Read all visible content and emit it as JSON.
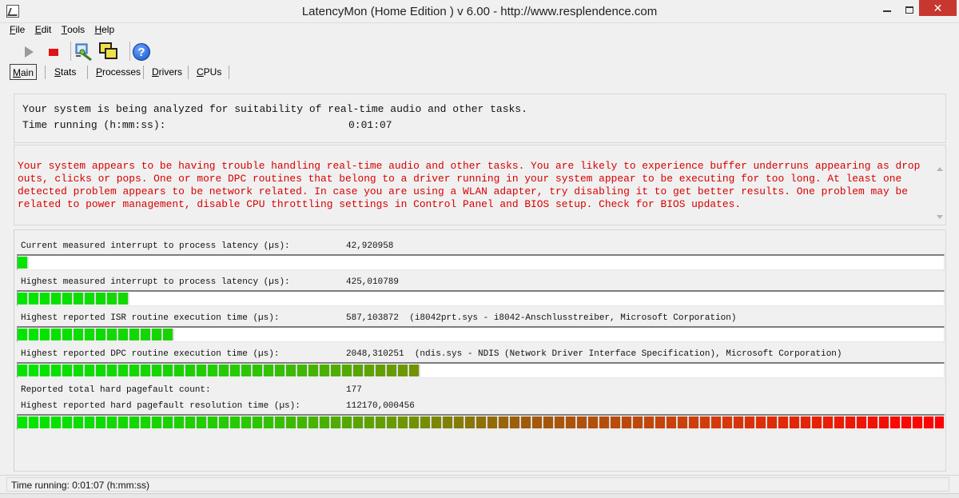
{
  "window": {
    "title": "LatencyMon  (Home Edition )  v 6.00 - http://www.resplendence.com"
  },
  "menu": [
    {
      "label": "File",
      "key": "F",
      "rest": "ile"
    },
    {
      "label": "Edit",
      "key": "E",
      "rest": "dit"
    },
    {
      "label": "Tools",
      "key": "T",
      "rest": "ools"
    },
    {
      "label": "Help",
      "key": "H",
      "rest": "elp"
    }
  ],
  "toolbar": {
    "icons": [
      "play-icon",
      "stop-icon",
      "tool-icon",
      "windows-icon",
      "help-icon"
    ],
    "help_glyph": "?"
  },
  "tabs": [
    {
      "label": "Main",
      "key": "M",
      "rest": "ain",
      "active": true
    },
    {
      "label": "Stats",
      "key": "S",
      "rest": "tats",
      "active": false
    },
    {
      "label": "Processes",
      "key": "P",
      "rest": "rocesses",
      "active": false
    },
    {
      "label": "Drivers",
      "key": "D",
      "rest": "rivers",
      "active": false
    },
    {
      "label": "CPUs",
      "key": "C",
      "rest": "PUs",
      "active": false
    }
  ],
  "status": {
    "line1": "Your system is being analyzed for suitability of real-time audio and other tasks.",
    "time_label": "Time running (h:mm:ss):",
    "time_value": "0:01:07"
  },
  "warning": {
    "text": "Your system appears to be having trouble handling real-time audio and other tasks. You are likely to experience buffer underruns appearing as drop outs, clicks or pops. One or more DPC routines that belong to a driver running in your system appear to be executing for too long. At least one detected problem appears to be network related. In case you are using a WLAN adapter, try disabling it to get better results. One problem may be related to power management, disable CPU throttling settings in Control Panel and BIOS setup. Check for BIOS updates.",
    "color": "#d90000"
  },
  "metrics": [
    {
      "label": "Current measured interrupt to process latency (µs):",
      "value": "42,920958",
      "fill": 0.012
    },
    {
      "label": "Highest measured interrupt to process latency (µs):",
      "value": "425,010789",
      "fill": 0.123
    },
    {
      "label": "Highest reported ISR routine execution time (µs):",
      "value": "587,103872  (i8042prt.sys - i8042-Anschlusstreiber, Microsoft Corporation)",
      "fill": 0.164
    },
    {
      "label": "Highest reported DPC routine execution time (µs):",
      "value": "2048,310251  (ndis.sys - NDIS (Network Driver Interface Specification), Microsoft Corporation)",
      "fill": 0.44
    },
    {
      "label": "Reported total hard pagefault count:",
      "value": "177",
      "fill": null
    },
    {
      "label": "Highest reported hard pagefault resolution time (µs):",
      "value": "112170,000456",
      "fill": 1.0
    }
  ],
  "statusbar": {
    "text": "Time running: 0:01:07  (h:mm:ss)"
  }
}
